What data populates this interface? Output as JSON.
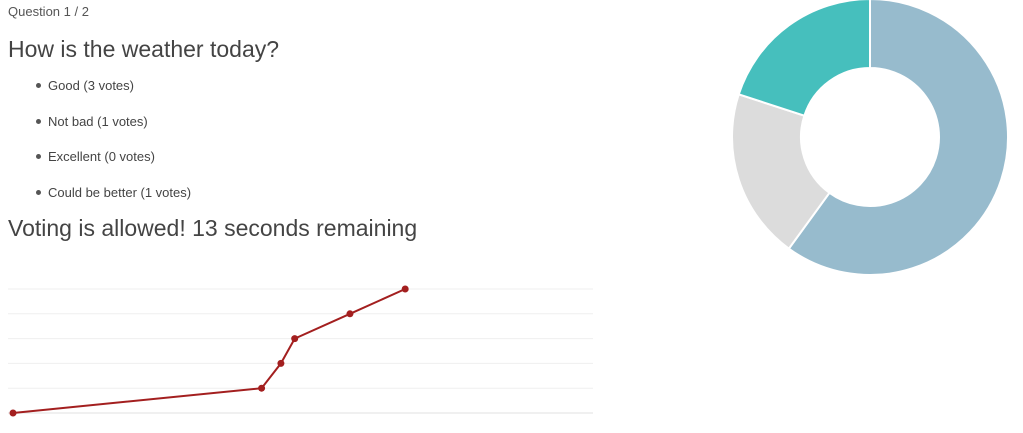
{
  "poll": {
    "question_counter": "Question 1 / 2",
    "question": "How is the weather today?",
    "options": [
      {
        "label": "Good (3 votes)"
      },
      {
        "label": "Not bad (1 votes)"
      },
      {
        "label": "Excellent (0 votes)"
      },
      {
        "label": "Could be better (1 votes)"
      }
    ],
    "status": "Voting is allowed! 13 seconds remaining"
  },
  "chart_data": [
    {
      "type": "line",
      "title": "",
      "xlabel": "",
      "ylabel": "",
      "grid": true,
      "ylim": [
        0,
        5
      ],
      "xlim": [
        0,
        10.5
      ],
      "color": "#a31f1f",
      "series": [
        {
          "x": [
            0,
            4.5,
            4.85,
            5.1,
            6.1,
            7.1
          ],
          "y": [
            0,
            1,
            2,
            3,
            4,
            5
          ]
        }
      ]
    },
    {
      "type": "pie",
      "variant": "donut",
      "labels": [
        "Good",
        "Not bad",
        "Excellent",
        "Could be better"
      ],
      "values": [
        3,
        1,
        0,
        1
      ],
      "colors": [
        "#97bbcd",
        "#dcdcdc",
        "#f7464a",
        "#46bfbd"
      ]
    }
  ]
}
